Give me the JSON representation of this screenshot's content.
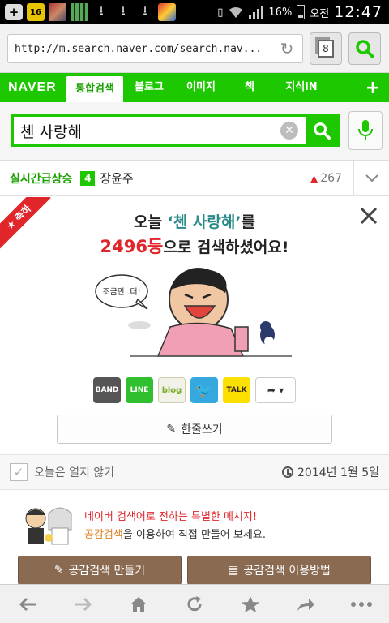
{
  "status_bar": {
    "notification_badge": "16",
    "battery": "16%",
    "ampm": "오전",
    "time": "12:47",
    "icons": [
      "add-icon",
      "notification-number-icon",
      "picture-icon",
      "grid-icon",
      "download-icon",
      "download-icon",
      "download-icon",
      "app-icon",
      "vibrate-icon",
      "wifi-icon",
      "signal-icon",
      "battery-icon"
    ]
  },
  "browser": {
    "url": "http://m.search.naver.com/search.nav...",
    "tab_count": "8"
  },
  "naver_nav": {
    "logo": "NAVER",
    "tabs": [
      {
        "label": "통합검색",
        "active": true
      },
      {
        "label": "블로그"
      },
      {
        "label": "이미지"
      },
      {
        "label": "책"
      },
      {
        "label": "지식iN"
      }
    ],
    "plus_label": "+"
  },
  "search": {
    "query": "첸 사랑해"
  },
  "realtime": {
    "label": "실시간급상승",
    "rank": "4",
    "keyword": "장윤주",
    "count": "267"
  },
  "congrats": {
    "ribbon": "축하",
    "line1_prefix": "오늘 ",
    "line1_query": "‘첸 사랑해’",
    "line1_suffix": "를",
    "rank": "2496등",
    "line2_suffix": "으로 검색하셨어요!",
    "speech": "조금만..더!",
    "share_labels": {
      "band": "BAND",
      "line": "LINE",
      "blog": "blog",
      "talk": "TALK"
    },
    "write_button": "한줄쓰기"
  },
  "card_footer": {
    "hide_today": "오늘은 열지 않기",
    "date": "2014년 1월 5일"
  },
  "promo": {
    "line1": "네이버 검색어로 전하는 특별한 메시지!",
    "line2_highlight": "공감검색",
    "line2_rest": "을 이용하여 직접 만들어 보세요.",
    "button_make": "공감검색 만들기",
    "button_howto": "공감검색 이용방법"
  },
  "colors": {
    "naver_green": "#1ec800",
    "red": "#e0262a",
    "brown_button": "#8b6a52"
  }
}
